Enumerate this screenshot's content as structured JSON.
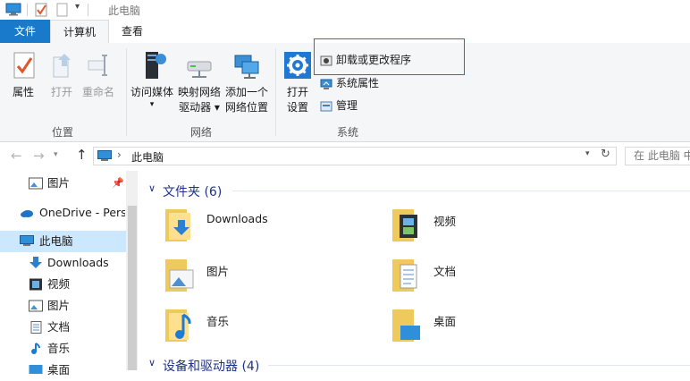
{
  "window": {
    "title": "此电脑"
  },
  "tabs": {
    "file": "文件",
    "computer": "计算机",
    "view": "查看"
  },
  "ribbon": {
    "location": {
      "label": "位置",
      "buttons": [
        "属性",
        "打开",
        "重命名"
      ]
    },
    "network": {
      "label": "网络",
      "buttons": [
        {
          "line1": "访问媒体",
          "line2": ""
        },
        {
          "line1": "映射网络",
          "line2": "驱动器"
        },
        {
          "line1": "添加一个",
          "line2": "网络位置"
        }
      ]
    },
    "system": {
      "label": "系统",
      "open_settings": {
        "line1": "打开",
        "line2": "设置"
      },
      "small": [
        "卸载或更改程序",
        "系统属性",
        "管理"
      ]
    }
  },
  "addressbar": {
    "path": "此电脑",
    "search_placeholder": "在 此电脑 中"
  },
  "navpane": {
    "items": [
      {
        "label": "图片",
        "icon": "pictures-icon"
      },
      {
        "label": "OneDrive - Perso",
        "icon": "onedrive-icon"
      },
      {
        "label": "此电脑",
        "icon": "this-pc-icon"
      },
      {
        "label": "Downloads",
        "icon": "downloads-icon"
      },
      {
        "label": "视频",
        "icon": "videos-icon"
      },
      {
        "label": "图片",
        "icon": "pictures-icon"
      },
      {
        "label": "文档",
        "icon": "documents-icon"
      },
      {
        "label": "音乐",
        "icon": "music-icon"
      },
      {
        "label": "桌面",
        "icon": "desktop-icon"
      }
    ]
  },
  "content": {
    "folders_header": "文件夹 (6)",
    "folders": [
      "Downloads",
      "视频",
      "图片",
      "文档",
      "音乐",
      "桌面"
    ],
    "devices_header": "设备和驱动器 (4)"
  },
  "colors": {
    "accent": "#1979ca",
    "highlight_border": "#c83a3a",
    "selected_bg": "#cce8ff"
  }
}
